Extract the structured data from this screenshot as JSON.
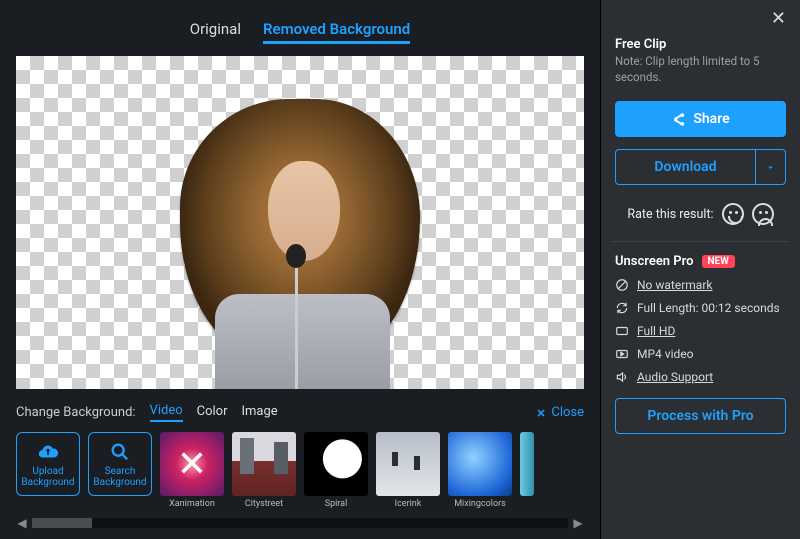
{
  "tabs": {
    "original": "Original",
    "removed": "Removed Background"
  },
  "bg": {
    "label": "Change Background:",
    "video": "Video",
    "color": "Color",
    "image": "Image",
    "close": "Close",
    "upload": "Upload Background",
    "search": "Search Background",
    "thumbs": {
      "xanimation": "Xanimation",
      "citystreet": "Citystreet",
      "spiral": "Spiral",
      "icerink": "Icerink",
      "mixingcolors": "Mixingcolors"
    }
  },
  "side": {
    "free_title": "Free Clip",
    "free_note": "Note: Clip length limited to 5 seconds.",
    "share": "Share",
    "download": "Download",
    "rate": "Rate this result:",
    "pro_title": "Unscreen Pro",
    "new_badge": "NEW",
    "feat_nowatermark": "No watermark",
    "feat_fulllength": "Full Length: 00:12 seconds",
    "feat_fullhd": "Full HD",
    "feat_mp4": "MP4 video",
    "feat_audio": "Audio Support",
    "process": "Process with Pro"
  }
}
